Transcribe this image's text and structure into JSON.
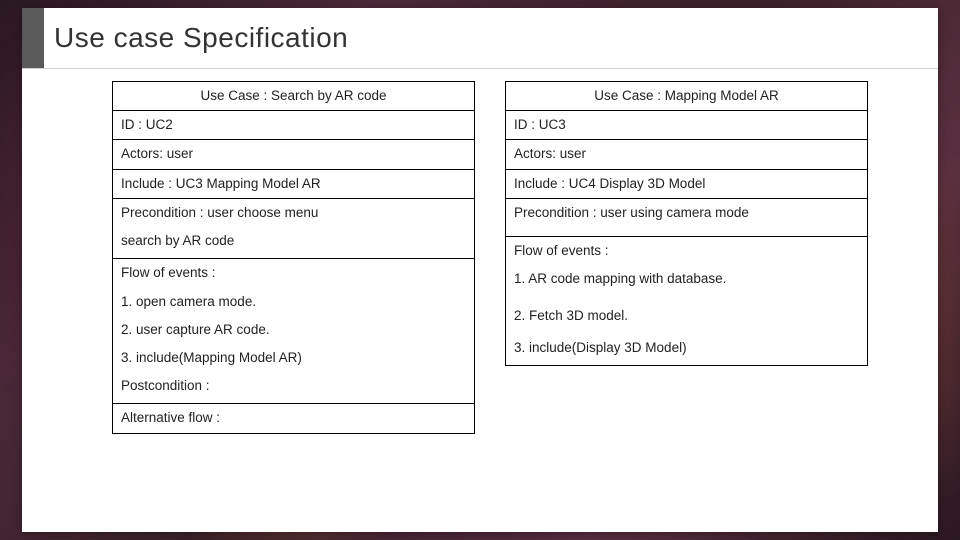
{
  "title": "Use case Specification",
  "uc_left": {
    "header": "Use Case : Search by AR code",
    "id": "ID : UC2",
    "actors": "Actors: user",
    "include": "Include : UC3 Mapping Model AR",
    "precondition_l1": "Precondition : user choose menu",
    "precondition_l2": "search by AR code",
    "flow_label": "Flow of events :",
    "flow_1": "1. open camera mode.",
    "flow_2": "2. user capture AR code.",
    "flow_3": "3. include(Mapping Model AR)",
    "postcondition": "Postcondition :",
    "altflow": "Alternative flow :"
  },
  "uc_right": {
    "header": "Use Case : Mapping Model AR",
    "id": "ID : UC3",
    "actors": "Actors: user",
    "include": "Include : UC4 Display 3D Model",
    "precondition": "Precondition : user using camera mode",
    "flow_label": "Flow of events :",
    "flow_1": "1. AR code mapping with database.",
    "flow_2": "2. Fetch 3D model.",
    "flow_3": "3. include(Display 3D Model)"
  }
}
